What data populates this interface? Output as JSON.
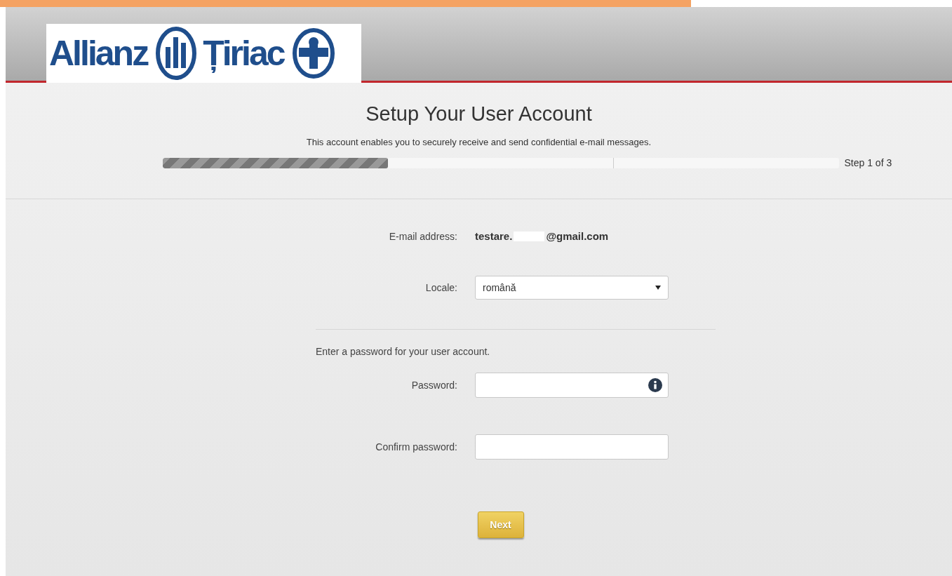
{
  "logo": {
    "words": [
      "Allianz",
      "Țiriac"
    ]
  },
  "heading": "Setup Your User Account",
  "subtitle": "This account enables you to securely receive and send confidential e-mail messages.",
  "progress": {
    "level": 0.334,
    "label": "Step 1 of 3"
  },
  "email": {
    "label": "E-mail address:",
    "value_start": "testare.",
    "value_end": "@gmail.com"
  },
  "locale": {
    "label": "Locale:",
    "value": "română"
  },
  "password_intro": "Enter a password for your user account.",
  "password": {
    "label": "Password:"
  },
  "confirm": {
    "label": "Confirm password:"
  },
  "next_button": "Next"
}
